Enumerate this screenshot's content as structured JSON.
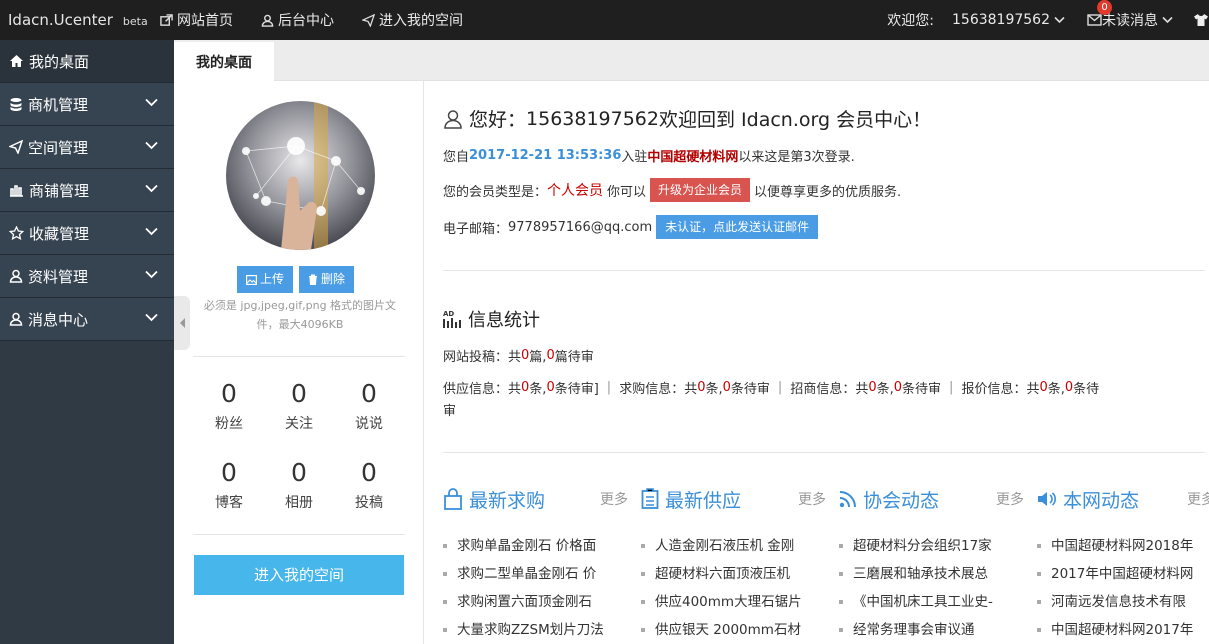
{
  "topbar": {
    "brand": "Idacn.Ucenter",
    "beta": "beta",
    "nav": [
      {
        "label": "网站首页",
        "icon": "external-link-icon"
      },
      {
        "label": "后台中心",
        "icon": "user-icon"
      },
      {
        "label": "进入我的空间",
        "icon": "send-icon"
      }
    ],
    "welcome": "欢迎您:",
    "username": "15638197562",
    "messages_label": "未读消息",
    "messages_count": "0"
  },
  "sidebar": {
    "items": [
      {
        "label": "我的桌面",
        "icon": "home-icon"
      },
      {
        "label": "商机管理",
        "icon": "database-icon"
      },
      {
        "label": "空间管理",
        "icon": "send-icon"
      },
      {
        "label": "商铺管理",
        "icon": "shop-icon"
      },
      {
        "label": "收藏管理",
        "icon": "star-icon"
      },
      {
        "label": "资料管理",
        "icon": "user-icon"
      },
      {
        "label": "消息中心",
        "icon": "user-icon"
      }
    ]
  },
  "tabs": {
    "active": "我的桌面"
  },
  "profile": {
    "upload_label": "上传",
    "delete_label": "删除",
    "hint": "必须是 jpg,jpeg,gif,png 格式的图片文件，最大4096KB",
    "stats": [
      {
        "num": "0",
        "label": "粉丝"
      },
      {
        "num": "0",
        "label": "关注"
      },
      {
        "num": "0",
        "label": "说说"
      },
      {
        "num": "0",
        "label": "博客"
      },
      {
        "num": "0",
        "label": "相册"
      },
      {
        "num": "0",
        "label": "投稿"
      }
    ],
    "enter_space": "进入我的空间"
  },
  "greeting": {
    "prefix": "您好：",
    "user": "15638197562",
    "suffix": " 欢迎回到 Idacn.org 会员中心！"
  },
  "login_info": {
    "p1": "您自",
    "date": "2017-12-21 13:53:36",
    "p2": "入驻",
    "site": "中国超硬材料网",
    "p3": "以来这是第3次登录."
  },
  "member": {
    "p1": "您的会员类型是：",
    "type": "个人会员",
    "p2": "你可以",
    "upgrade": "升级为企业会员",
    "p3": "以便尊享更多的优质服务."
  },
  "email": {
    "label": "电子邮箱：",
    "value": "9778957166@qq.com",
    "verify": "未认证，点此发送认证邮件"
  },
  "stats_section": {
    "title": "信息统计",
    "posts": {
      "p1": "网站投稿：共 ",
      "a": "0",
      "p2": " 篇, ",
      "b": "0",
      "p3": " 篇待审"
    },
    "supply": {
      "p1": "供应信息：共 ",
      "a": "0",
      "p2": " 条, ",
      "b": "0",
      "p3": " 条待审]"
    },
    "buy": {
      "p1": "求购信息：共 ",
      "a": "0",
      "p2": " 条, ",
      "b": "0",
      "p3": " 条待审"
    },
    "invest": {
      "p1": "招商信息：共 ",
      "a": "0",
      "p2": " 条, ",
      "b": "0",
      "p3": " 条待审"
    },
    "quote": {
      "p1": "报价信息：共 ",
      "a": "0",
      "p2": " 条, ",
      "b": "0",
      "p3": " 条待"
    },
    "quote_wrap": "审"
  },
  "news": [
    {
      "title": "最新求购",
      "icon": "bag-icon",
      "more": "更多",
      "items": [
        "求购单晶金刚石 价格面",
        "求购二型单晶金刚石 价",
        "求购闲置六面顶金刚石",
        "大量求购ZZSM划片刀法"
      ]
    },
    {
      "title": "最新供应",
      "icon": "list-icon",
      "more": "更多",
      "items": [
        "人造金刚石液压机 金刚",
        "超硬材料六面顶液压机",
        "供应400mm大理石锯片",
        "供应银天 2000mm石材"
      ]
    },
    {
      "title": "协会动态",
      "icon": "rss-icon",
      "more": "更多",
      "items": [
        "超硬材料分会组织17家",
        "三磨展和轴承技术展总",
        "《中国机床工具工业史-",
        "经常务理事会审议通"
      ]
    },
    {
      "title": "本网动态",
      "icon": "volume-icon",
      "more": "更多",
      "items": [
        "中国超硬材料网2018年",
        "2017年中国超硬材料网",
        "河南远发信息技术有限",
        "中国超硬材料网2017年"
      ]
    }
  ]
}
